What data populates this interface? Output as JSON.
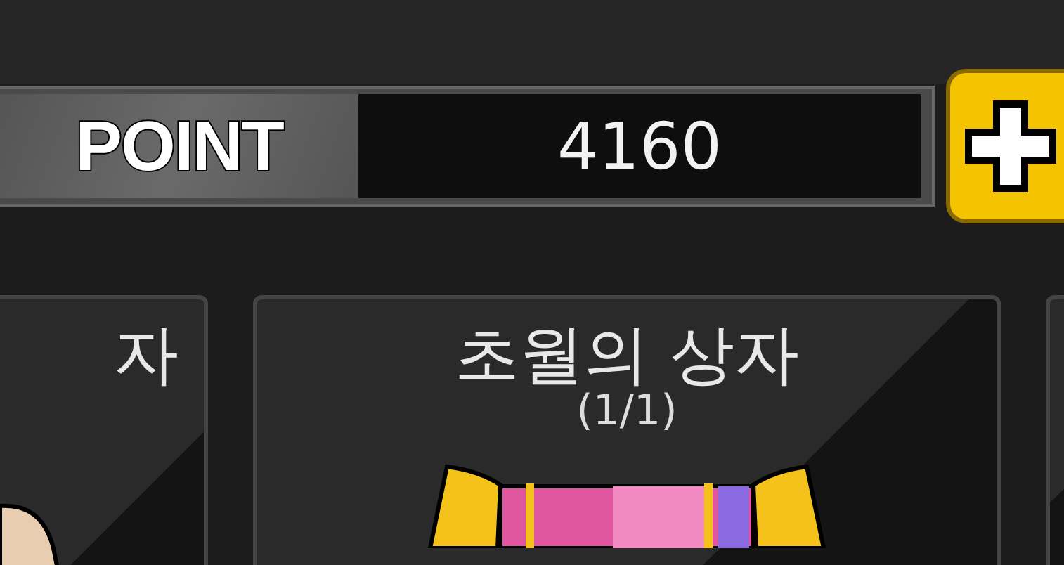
{
  "point_bar": {
    "label": "POINT",
    "value": "4160"
  },
  "cards": [
    {
      "kind": "partial",
      "title": "자"
    },
    {
      "kind": "full",
      "title": "초월의 상자",
      "count": "(1/1)"
    },
    {
      "kind": "edge"
    }
  ]
}
